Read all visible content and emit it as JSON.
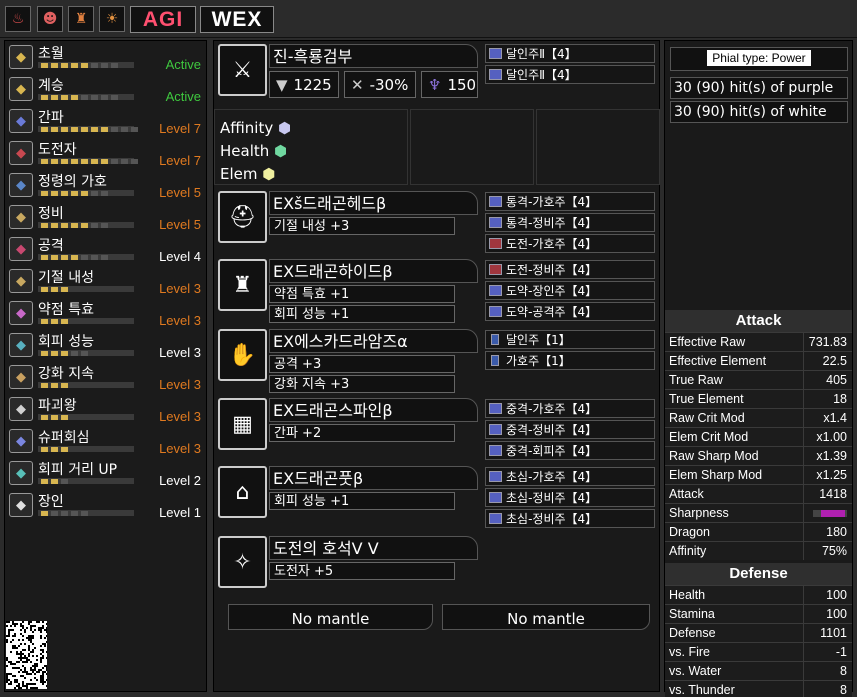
{
  "topbar": {
    "icons": [
      "fire-pot-icon",
      "spiked-mask-icon",
      "fire-bottle-icon",
      "sun-mask-icon"
    ],
    "words": [
      "AGI",
      "WEX"
    ]
  },
  "skills": [
    {
      "name": "초월",
      "level": "Active",
      "pips": 5,
      "max": 8,
      "status": "active",
      "color": "#d8b650"
    },
    {
      "name": "계승",
      "level": "Active",
      "pips": 4,
      "max": 8,
      "status": "active",
      "color": "#d8b650"
    },
    {
      "name": "간파",
      "level": "Level 7",
      "pips": 7,
      "max": 10,
      "status": "partial",
      "color": "#6a7ad8"
    },
    {
      "name": "도전자",
      "level": "Level 7",
      "pips": 7,
      "max": 10,
      "status": "partial",
      "color": "#c84850"
    },
    {
      "name": "정령의 가호",
      "level": "Level 5",
      "pips": 5,
      "max": 7,
      "status": "partial",
      "color": "#5a86c8"
    },
    {
      "name": "정비",
      "level": "Level 5",
      "pips": 5,
      "max": 7,
      "status": "partial",
      "color": "#c8a860"
    },
    {
      "name": "공격",
      "level": "Level 4",
      "pips": 4,
      "max": 7,
      "status": "max",
      "color": "#c84870"
    },
    {
      "name": "기절 내성",
      "level": "Level 3",
      "pips": 3,
      "max": 3,
      "status": "partial",
      "color": "#c8a860"
    },
    {
      "name": "약점 특효",
      "level": "Level 3",
      "pips": 3,
      "max": 3,
      "status": "partial",
      "color": "#c868c8"
    },
    {
      "name": "회피 성능",
      "level": "Level 3",
      "pips": 3,
      "max": 5,
      "status": "max",
      "color": "#58b0c0"
    },
    {
      "name": "강화 지속",
      "level": "Level 3",
      "pips": 3,
      "max": 3,
      "status": "partial",
      "color": "#c8a060"
    },
    {
      "name": "파괴왕",
      "level": "Level 3",
      "pips": 3,
      "max": 3,
      "status": "partial",
      "color": "#d0d0d0"
    },
    {
      "name": "슈퍼회심",
      "level": "Level 3",
      "pips": 3,
      "max": 3,
      "status": "partial",
      "color": "#7a86e0"
    },
    {
      "name": "회피 거리 UP",
      "level": "Level 2",
      "pips": 2,
      "max": 3,
      "status": "max",
      "color": "#58c0b8"
    },
    {
      "name": "장인",
      "level": "Level 1",
      "pips": 1,
      "max": 5,
      "status": "max",
      "color": "#e0e0e0"
    }
  ],
  "weapon": {
    "name": "진-흑룡검부",
    "attack": "1225",
    "affinity": "-30%",
    "element": "150",
    "icon": "charge-blade-icon",
    "decos": [
      "달인주Ⅱ【4】",
      "달인주Ⅱ【4】"
    ],
    "attrs": [
      {
        "label": "Affinity",
        "color": "#c8c8f0"
      },
      {
        "label": "Health",
        "color": "#70d8a0"
      },
      {
        "label": "Elem",
        "color": "#f0f0a0"
      }
    ]
  },
  "armor": [
    {
      "name": "EXš드래곤헤드β",
      "icon": "helm-icon",
      "skills": [
        "기절 내성 +3"
      ],
      "decos": [
        {
          "t": "통격-가호주【4】",
          "c": "blue"
        },
        {
          "t": "통격-정비주【4】",
          "c": "blue"
        },
        {
          "t": "도전-가호주【4】",
          "c": "red"
        }
      ]
    },
    {
      "name": "EX드래곤하이드β",
      "icon": "chest-icon",
      "skills": [
        "약점 특효 +1",
        "회피 성능 +1"
      ],
      "decos": [
        {
          "t": "도전-정비주【4】",
          "c": "red"
        },
        {
          "t": "도약-장인주【4】",
          "c": "blue"
        },
        {
          "t": "도약-공격주【4】",
          "c": "blue"
        }
      ]
    },
    {
      "name": "EX에스카드라암즈α",
      "icon": "arms-icon",
      "skills": [
        "공격 +3",
        "강화 지속 +3"
      ],
      "decos": [
        {
          "t": "달인주【1】",
          "c": "tiny"
        },
        {
          "t": "가호주【1】",
          "c": "tiny"
        }
      ]
    },
    {
      "name": "EX드래곤스파인β",
      "icon": "waist-icon",
      "skills": [
        "간파 +2"
      ],
      "decos": [
        {
          "t": "중격-가호주【4】",
          "c": "blue"
        },
        {
          "t": "중격-정비주【4】",
          "c": "blue"
        },
        {
          "t": "중격-회피주【4】",
          "c": "blue"
        }
      ]
    },
    {
      "name": "EX드래곤풋β",
      "icon": "legs-icon",
      "skills": [
        "회피 성능 +1"
      ],
      "decos": [
        {
          "t": "초심-가호주【4】",
          "c": "blue"
        },
        {
          "t": "초심-정비주【4】",
          "c": "blue"
        },
        {
          "t": "초심-정비주【4】",
          "c": "blue"
        }
      ]
    }
  ],
  "charm": {
    "name": "도전의 호석Ⅴ V",
    "icon": "charm-icon",
    "skills": [
      "도전자 +5"
    ]
  },
  "mantles": [
    "No mantle",
    "No mantle"
  ],
  "phial": {
    "title": "Phial type: Power",
    "line1": "30 (90) hit(s) of purple",
    "line2": "30 (90) hit(s) of white"
  },
  "attack": {
    "title": "Attack",
    "rows": [
      {
        "k": "Effective Raw",
        "v": "731.83"
      },
      {
        "k": "Effective Element",
        "v": "22.5"
      },
      {
        "k": "True Raw",
        "v": "405"
      },
      {
        "k": "True Element",
        "v": "18"
      },
      {
        "k": "Raw Crit Mod",
        "v": "x1.4"
      },
      {
        "k": "Elem Crit Mod",
        "v": "x1.00"
      },
      {
        "k": "Raw Sharp Mod",
        "v": "x1.39"
      },
      {
        "k": "Elem Sharp Mod",
        "v": "x1.25"
      },
      {
        "k": "Attack",
        "v": "1418"
      },
      {
        "k": "Sharpness",
        "v": ""
      },
      {
        "k": "Dragon",
        "v": "180"
      },
      {
        "k": "Affinity",
        "v": "75%"
      }
    ]
  },
  "defense": {
    "title": "Defense",
    "rows": [
      {
        "k": "Health",
        "v": "100"
      },
      {
        "k": "Stamina",
        "v": "100"
      },
      {
        "k": "Defense",
        "v": "1101"
      },
      {
        "k": "vs. Fire",
        "v": "-1"
      },
      {
        "k": "vs. Water",
        "v": "8"
      },
      {
        "k": "vs. Thunder",
        "v": "8"
      }
    ]
  }
}
